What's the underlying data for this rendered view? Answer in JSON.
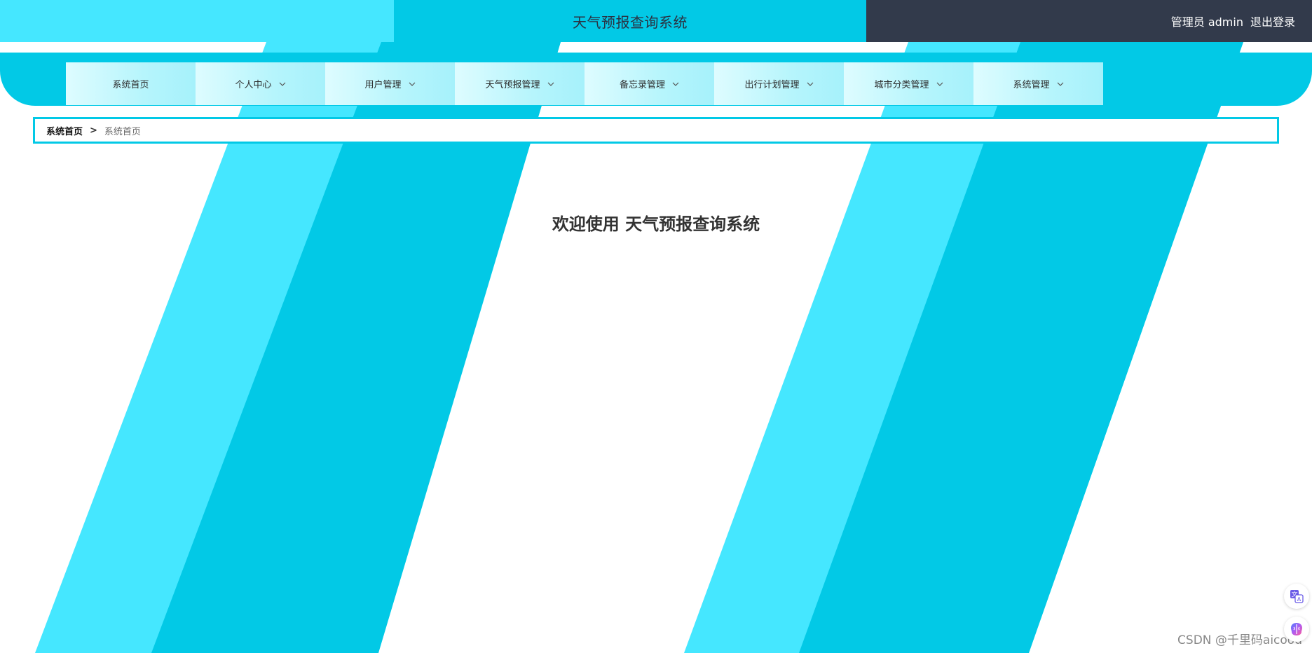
{
  "header": {
    "app_title": "天气预报查询系统",
    "user_info": "管理员 admin",
    "logout_label": "退出登录"
  },
  "nav": {
    "items": [
      {
        "label": "系统首页",
        "has_dropdown": false
      },
      {
        "label": "个人中心",
        "has_dropdown": true
      },
      {
        "label": "用户管理",
        "has_dropdown": true
      },
      {
        "label": "天气预报管理",
        "has_dropdown": true
      },
      {
        "label": "备忘录管理",
        "has_dropdown": true
      },
      {
        "label": "出行计划管理",
        "has_dropdown": true
      },
      {
        "label": "城市分类管理",
        "has_dropdown": true
      },
      {
        "label": "系统管理",
        "has_dropdown": true
      }
    ]
  },
  "breadcrumb": {
    "home": "系统首页",
    "separator": ">",
    "current": "系统首页"
  },
  "main": {
    "welcome_text": "欢迎使用 天气预报查询系统"
  },
  "watermark": "CSDN @千里码aicood",
  "colors": {
    "stripe_light": "#45e7ff",
    "stripe_dark": "#02c9e6",
    "header_dark": "#323a4b"
  },
  "icons": {
    "dropdown": "chevron-down-icon",
    "translate": "translate-icon",
    "assistant": "brain-icon"
  }
}
